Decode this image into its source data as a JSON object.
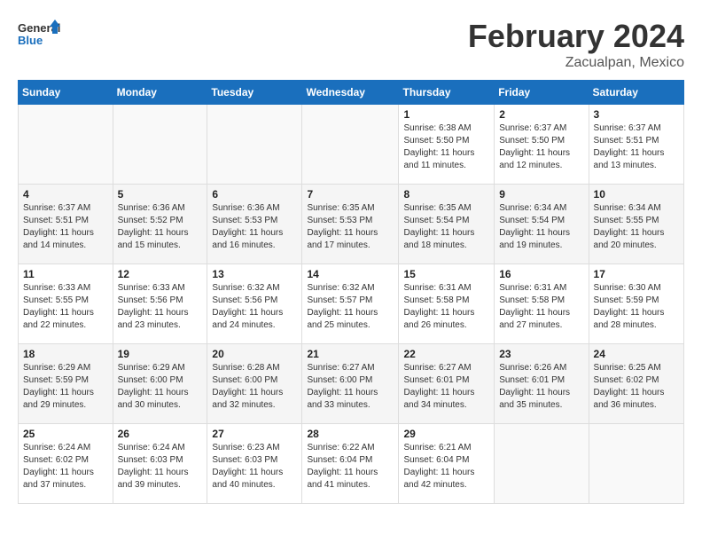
{
  "header": {
    "logo": {
      "general": "General",
      "blue": "Blue"
    },
    "title": "February 2024",
    "subtitle": "Zacualpan, Mexico"
  },
  "weekdays": [
    "Sunday",
    "Monday",
    "Tuesday",
    "Wednesday",
    "Thursday",
    "Friday",
    "Saturday"
  ],
  "weeks": [
    [
      {
        "day": "",
        "info": ""
      },
      {
        "day": "",
        "info": ""
      },
      {
        "day": "",
        "info": ""
      },
      {
        "day": "",
        "info": ""
      },
      {
        "day": "1",
        "info": "Sunrise: 6:38 AM\nSunset: 5:50 PM\nDaylight: 11 hours and 11 minutes."
      },
      {
        "day": "2",
        "info": "Sunrise: 6:37 AM\nSunset: 5:50 PM\nDaylight: 11 hours and 12 minutes."
      },
      {
        "day": "3",
        "info": "Sunrise: 6:37 AM\nSunset: 5:51 PM\nDaylight: 11 hours and 13 minutes."
      }
    ],
    [
      {
        "day": "4",
        "info": "Sunrise: 6:37 AM\nSunset: 5:51 PM\nDaylight: 11 hours and 14 minutes."
      },
      {
        "day": "5",
        "info": "Sunrise: 6:36 AM\nSunset: 5:52 PM\nDaylight: 11 hours and 15 minutes."
      },
      {
        "day": "6",
        "info": "Sunrise: 6:36 AM\nSunset: 5:53 PM\nDaylight: 11 hours and 16 minutes."
      },
      {
        "day": "7",
        "info": "Sunrise: 6:35 AM\nSunset: 5:53 PM\nDaylight: 11 hours and 17 minutes."
      },
      {
        "day": "8",
        "info": "Sunrise: 6:35 AM\nSunset: 5:54 PM\nDaylight: 11 hours and 18 minutes."
      },
      {
        "day": "9",
        "info": "Sunrise: 6:34 AM\nSunset: 5:54 PM\nDaylight: 11 hours and 19 minutes."
      },
      {
        "day": "10",
        "info": "Sunrise: 6:34 AM\nSunset: 5:55 PM\nDaylight: 11 hours and 20 minutes."
      }
    ],
    [
      {
        "day": "11",
        "info": "Sunrise: 6:33 AM\nSunset: 5:55 PM\nDaylight: 11 hours and 22 minutes."
      },
      {
        "day": "12",
        "info": "Sunrise: 6:33 AM\nSunset: 5:56 PM\nDaylight: 11 hours and 23 minutes."
      },
      {
        "day": "13",
        "info": "Sunrise: 6:32 AM\nSunset: 5:56 PM\nDaylight: 11 hours and 24 minutes."
      },
      {
        "day": "14",
        "info": "Sunrise: 6:32 AM\nSunset: 5:57 PM\nDaylight: 11 hours and 25 minutes."
      },
      {
        "day": "15",
        "info": "Sunrise: 6:31 AM\nSunset: 5:58 PM\nDaylight: 11 hours and 26 minutes."
      },
      {
        "day": "16",
        "info": "Sunrise: 6:31 AM\nSunset: 5:58 PM\nDaylight: 11 hours and 27 minutes."
      },
      {
        "day": "17",
        "info": "Sunrise: 6:30 AM\nSunset: 5:59 PM\nDaylight: 11 hours and 28 minutes."
      }
    ],
    [
      {
        "day": "18",
        "info": "Sunrise: 6:29 AM\nSunset: 5:59 PM\nDaylight: 11 hours and 29 minutes."
      },
      {
        "day": "19",
        "info": "Sunrise: 6:29 AM\nSunset: 6:00 PM\nDaylight: 11 hours and 30 minutes."
      },
      {
        "day": "20",
        "info": "Sunrise: 6:28 AM\nSunset: 6:00 PM\nDaylight: 11 hours and 32 minutes."
      },
      {
        "day": "21",
        "info": "Sunrise: 6:27 AM\nSunset: 6:00 PM\nDaylight: 11 hours and 33 minutes."
      },
      {
        "day": "22",
        "info": "Sunrise: 6:27 AM\nSunset: 6:01 PM\nDaylight: 11 hours and 34 minutes."
      },
      {
        "day": "23",
        "info": "Sunrise: 6:26 AM\nSunset: 6:01 PM\nDaylight: 11 hours and 35 minutes."
      },
      {
        "day": "24",
        "info": "Sunrise: 6:25 AM\nSunset: 6:02 PM\nDaylight: 11 hours and 36 minutes."
      }
    ],
    [
      {
        "day": "25",
        "info": "Sunrise: 6:24 AM\nSunset: 6:02 PM\nDaylight: 11 hours and 37 minutes."
      },
      {
        "day": "26",
        "info": "Sunrise: 6:24 AM\nSunset: 6:03 PM\nDaylight: 11 hours and 39 minutes."
      },
      {
        "day": "27",
        "info": "Sunrise: 6:23 AM\nSunset: 6:03 PM\nDaylight: 11 hours and 40 minutes."
      },
      {
        "day": "28",
        "info": "Sunrise: 6:22 AM\nSunset: 6:04 PM\nDaylight: 11 hours and 41 minutes."
      },
      {
        "day": "29",
        "info": "Sunrise: 6:21 AM\nSunset: 6:04 PM\nDaylight: 11 hours and 42 minutes."
      },
      {
        "day": "",
        "info": ""
      },
      {
        "day": "",
        "info": ""
      }
    ]
  ]
}
